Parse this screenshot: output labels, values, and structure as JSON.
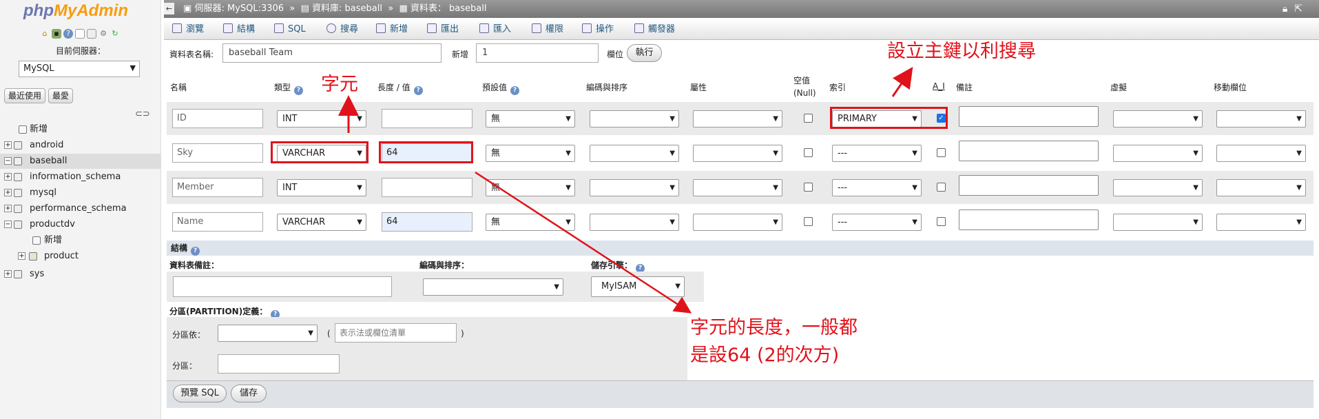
{
  "sidebar": {
    "logo_php": "php",
    "logo_myadmin": "MyAdmin",
    "server_label": "目前伺服器：",
    "server_value": "MySQL",
    "recent_btn": "最近使用",
    "favorites_btn": "最愛",
    "tree": [
      {
        "label": "新增",
        "level": 1,
        "type": "new"
      },
      {
        "label": "android",
        "level": 0,
        "type": "db"
      },
      {
        "label": "baseball",
        "level": 0,
        "type": "db",
        "selected": true
      },
      {
        "label": "information_schema",
        "level": 0,
        "type": "db"
      },
      {
        "label": "mysql",
        "level": 0,
        "type": "db"
      },
      {
        "label": "performance_schema",
        "level": 0,
        "type": "db"
      },
      {
        "label": "productdv",
        "level": 0,
        "type": "db"
      },
      {
        "label": "新增",
        "level": 2,
        "type": "new"
      },
      {
        "label": "product",
        "level": 2,
        "type": "table"
      },
      {
        "label": "sys",
        "level": 0,
        "type": "db"
      }
    ]
  },
  "breadcrumb": {
    "server": "伺服器: MySQL:3306",
    "database": "資料庫: baseball",
    "table": "資料表： baseball",
    "sep": "»"
  },
  "tabs": [
    "瀏覽",
    "結構",
    "SQL",
    "搜尋",
    "新增",
    "匯出",
    "匯入",
    "權限",
    "操作",
    "觸發器"
  ],
  "form": {
    "table_name_label": "資料表名稱:",
    "table_name_value": "baseball Team",
    "add_label": "新增",
    "add_value": "1",
    "column_label": "欄位",
    "go_button": "執行"
  },
  "headers": {
    "name": "名稱",
    "type": "類型",
    "length": "長度 / 值",
    "default": "預設值",
    "collation": "編碼與排序",
    "attributes": "屬性",
    "null": "空值 (Null)",
    "index": "索引",
    "ai": "A_I",
    "comments": "備註",
    "virtuality": "虛擬",
    "move": "移動欄位"
  },
  "rows": [
    {
      "name": "ID",
      "type": "INT",
      "length": "",
      "default": "無",
      "index": "PRIMARY",
      "ai": true
    },
    {
      "name": "Sky",
      "type": "VARCHAR",
      "length": "64",
      "default": "無",
      "index": "---",
      "ai": false
    },
    {
      "name": "Member",
      "type": "INT",
      "length": "",
      "default": "無",
      "index": "---",
      "ai": false
    },
    {
      "name": "Name",
      "type": "VARCHAR",
      "length": "64",
      "default": "無",
      "index": "---",
      "ai": false
    }
  ],
  "structure": {
    "section_label": "結構",
    "table_comment_label": "資料表備註：",
    "collation_label": "編碼與排序：",
    "engine_label": "儲存引擎：",
    "engine_value": "MyISAM"
  },
  "partition": {
    "label": "分區(PARTITION)定義：",
    "partition_by_label": "分區依：",
    "expr_placeholder": "表示法或欄位清單",
    "partitions_label": "分區："
  },
  "footer": {
    "preview_sql": "預覽 SQL",
    "save": "儲存"
  },
  "annotations": {
    "char": "字元",
    "primary_key": "設立主鍵以利搜尋",
    "length_line1": "字元的長度，一般都",
    "length_line2": "是設64 (2的次方)",
    "color": "#e0121b"
  }
}
